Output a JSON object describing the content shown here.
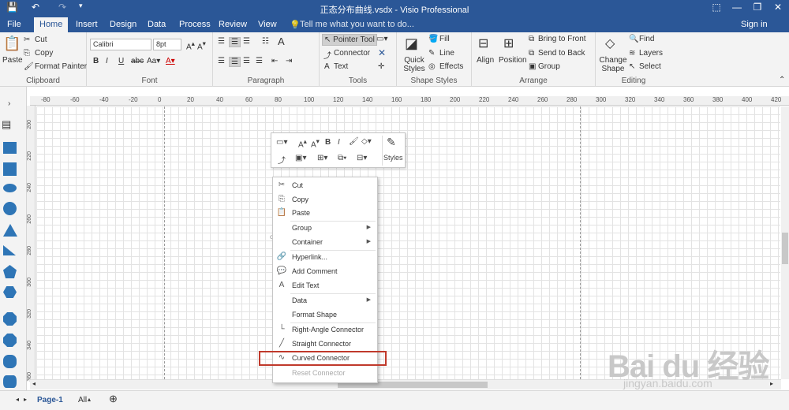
{
  "window": {
    "title": "正态分布曲线.vsdx - Visio Professional"
  },
  "ribbon_tabs": [
    "File",
    "Home",
    "Insert",
    "Design",
    "Data",
    "Process",
    "Review",
    "View"
  ],
  "tell_me": "Tell me what you want to do...",
  "sign_in": "Sign in",
  "clipboard": {
    "paste": "Paste",
    "cut": "Cut",
    "copy": "Copy",
    "format_painter": "Format Painter",
    "label": "Clipboard"
  },
  "font": {
    "name": "Calibri",
    "size": "8pt",
    "label": "Font"
  },
  "paragraph": {
    "label": "Paragraph"
  },
  "tools": {
    "pointer": "Pointer Tool",
    "connector": "Connector",
    "text": "Text",
    "label": "Tools"
  },
  "shape_styles": {
    "quick_styles": "Quick Styles",
    "fill": "Fill",
    "line": "Line",
    "effects": "Effects",
    "label": "Shape Styles"
  },
  "arrange": {
    "align": "Align",
    "position": "Position",
    "bring_front": "Bring to Front",
    "send_back": "Send to Back",
    "group": "Group",
    "label": "Arrange"
  },
  "editing": {
    "change_shape": "Change Shape",
    "find": "Find",
    "layers": "Layers",
    "select": "Select",
    "label": "Editing"
  },
  "ruler_h": [
    "-80",
    "-60",
    "-40",
    "-20",
    "0",
    "20",
    "40",
    "60",
    "80",
    "100",
    "120",
    "140",
    "160",
    "180",
    "200",
    "220",
    "240",
    "260",
    "280",
    "300",
    "320",
    "340",
    "360",
    "380",
    "400",
    "420"
  ],
  "ruler_v": [
    "200",
    "220",
    "240",
    "260",
    "280",
    "300",
    "320",
    "340",
    "360"
  ],
  "mini_toolbar": {
    "styles": "Styles"
  },
  "context_menu": [
    {
      "label": "Cut",
      "icon": "✂"
    },
    {
      "label": "Copy",
      "icon": "⎘"
    },
    {
      "label": "Paste",
      "icon": "📋"
    },
    {
      "label": "Group",
      "submenu": true
    },
    {
      "label": "Container",
      "submenu": true
    },
    {
      "label": "Hyperlink...",
      "icon": "🔗"
    },
    {
      "label": "Add Comment",
      "icon": "💬"
    },
    {
      "label": "Edit Text",
      "icon": "A"
    },
    {
      "label": "Data",
      "submenu": true
    },
    {
      "label": "Format Shape"
    },
    {
      "label": "Right-Angle Connector",
      "icon": "└"
    },
    {
      "label": "Straight Connector",
      "icon": "╱"
    },
    {
      "label": "Curved Connector",
      "icon": "∿"
    },
    {
      "label": "Reset Connector",
      "disabled": true
    }
  ],
  "status": {
    "page": "Page-1",
    "all": "All"
  },
  "watermark": {
    "brand": "Bai du 经验",
    "url": "jingyan.baidu.com"
  }
}
